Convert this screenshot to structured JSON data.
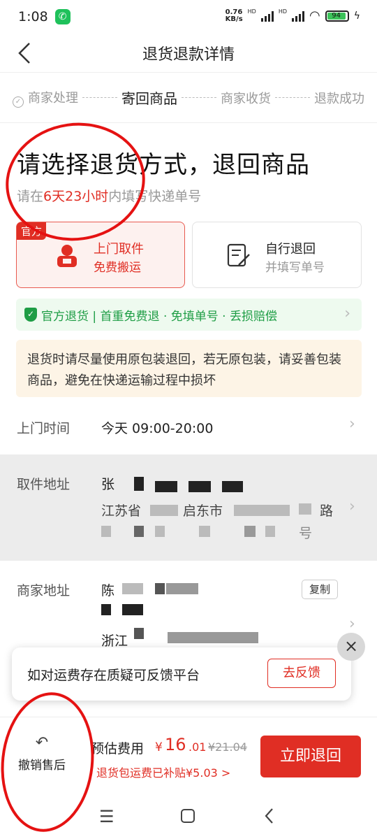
{
  "status": {
    "time": "1:08",
    "net_speed": "0.76\nKB/s",
    "hd1": "HD",
    "hd2": "HD",
    "battery": "94"
  },
  "header": {
    "title": "退货退款详情"
  },
  "steps": [
    {
      "label": "商家处理"
    },
    {
      "label": "寄回商品"
    },
    {
      "label": "商家收货"
    },
    {
      "label": "退款成功"
    }
  ],
  "main": {
    "title": "请选择退货方式，退回商品",
    "deadline_prefix": "请在",
    "deadline_time": "6天23小时",
    "deadline_suffix": "内填写快递单号"
  },
  "options": {
    "official_tag": "官方",
    "pickup_title": "上门取件",
    "pickup_sub": "免费搬运",
    "self_title": "自行退回",
    "self_sub": "并填写单号"
  },
  "banner": {
    "text": "官方退货 | 首重免费退 · 免填单号 · 丢损赔偿"
  },
  "notice": {
    "text": "退货时请尽量使用原包装退回，若无原包装，请妥善包装商品，避免在快递运输过程中损坏"
  },
  "pickup_time": {
    "label": "上门时间",
    "value": "今天 09:00-20:00"
  },
  "pickup_address": {
    "label": "取件地址",
    "name_prefix": "张",
    "line2_a": "江苏省",
    "line2_b": "启东市",
    "line2_c": "路",
    "line3_end": "号"
  },
  "merchant_address": {
    "label": "商家地址",
    "name_prefix": "陈",
    "line3": "浙江",
    "copy": "复制"
  },
  "toast": {
    "text": "如对运费存在质疑可反馈平台",
    "button": "去反馈"
  },
  "bottom": {
    "cancel": "撤销售后",
    "fee_label": "预估费用",
    "currency": "¥",
    "fee_main": "16",
    "fee_dec": ".01",
    "fee_old": "¥21.04",
    "subsidy": "退货包运费已补贴¥5.03 >",
    "return_btn": "立即退回"
  },
  "colors": {
    "accent": "#e02e24",
    "green": "#1e9d45"
  }
}
